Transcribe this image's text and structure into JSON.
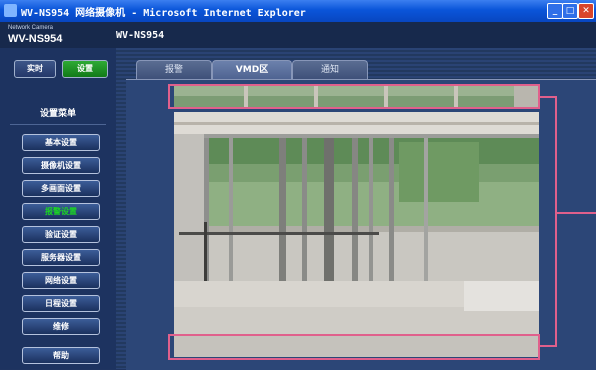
{
  "window": {
    "title": "WV-NS954 网络摄像机 - Microsoft Internet Explorer",
    "minimize": "_",
    "maximize": "□",
    "close": "✕"
  },
  "header": {
    "brand": "Network Camera",
    "model": "WV-NS954",
    "page_title": "WV-NS954"
  },
  "mode_tabs": {
    "live": "实时",
    "setup": "设置"
  },
  "menu": {
    "title": "设置菜单",
    "items": [
      "基本设置",
      "摄像机设置",
      "多画面设置",
      "报警设置",
      "验证设置",
      "服务器设置",
      "网络设置",
      "日程设置",
      "维修"
    ],
    "active_index": 3,
    "help": "帮助"
  },
  "tabs": [
    "报警",
    "VMD区",
    "通知"
  ],
  "active_tab": 1,
  "colors": {
    "vmd_area": "#e0608c",
    "active_menu": "#1bd622"
  }
}
